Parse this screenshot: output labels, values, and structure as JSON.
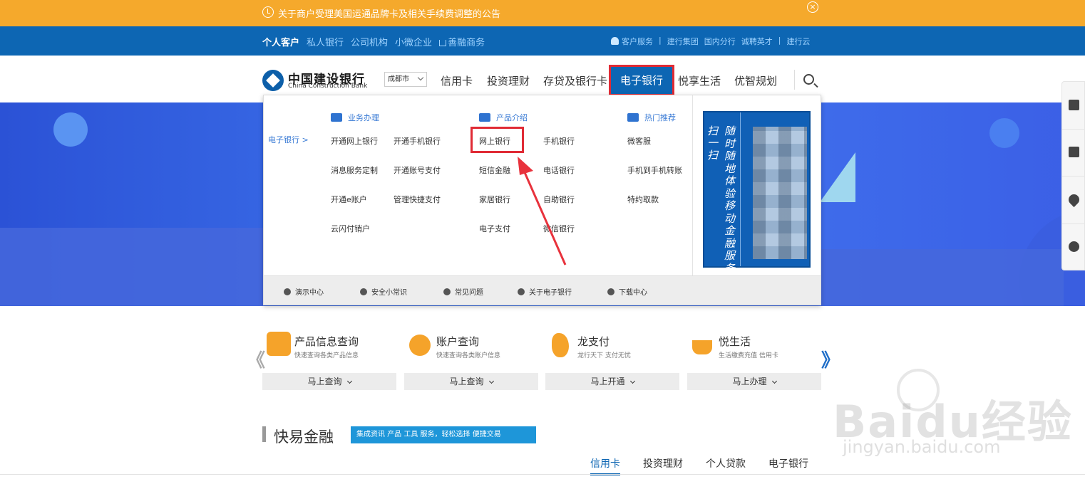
{
  "notice": {
    "text": "关于商户受理美国运通品牌卡及相关手续费调整的公告"
  },
  "topnav": {
    "left": [
      "个人客户",
      "私人银行",
      "公司机构",
      "小微企业",
      "善融商务"
    ],
    "right": [
      "客户服务",
      "|",
      "建行集团",
      "国内分行",
      "诚聘英才",
      "|",
      "建行云"
    ]
  },
  "header": {
    "logo_cn": "中国建设银行",
    "logo_en": "China Construction Bank",
    "city": "成都市",
    "nav": [
      "信用卡",
      "投资理财",
      "存贷及银行卡",
      "电子银行",
      "悦享生活",
      "优智规划"
    ]
  },
  "dropdown": {
    "category": "电子银行 >",
    "sections": {
      "business": "业务办理",
      "products": "产品介绍",
      "hot": "热门推荐"
    },
    "business_items": [
      "开通网上银行",
      "开通手机银行",
      "消息服务定制",
      "开通账号支付",
      "开通e账户",
      "管理快捷支付",
      "云闪付销户"
    ],
    "product_items": [
      "网上银行",
      "手机银行",
      "短信金融",
      "电话银行",
      "家居银行",
      "自助银行",
      "电子支付",
      "微信银行"
    ],
    "hot_items": [
      "微客服",
      "手机到手机转账",
      "特约取款"
    ],
    "promo_v1": "扫一扫",
    "promo_v2": "随时随地体验移动金融服务",
    "footer": [
      "演示中心",
      "安全小常识",
      "常见问题",
      "关于电子银行",
      "下载中心"
    ]
  },
  "services": [
    {
      "title": "产品信息查询",
      "desc": "快速查询各类产品信息",
      "button": "马上查询"
    },
    {
      "title": "账户查询",
      "desc": "快速查询各类账户信息",
      "button": "马上查询"
    },
    {
      "title": "龙支付",
      "desc": "龙行天下 支付无忧",
      "button": "马上开通"
    },
    {
      "title": "悦生活",
      "desc": "生活缴费充值 信用卡",
      "button": "马上办理"
    }
  ],
  "pager": {
    "prev": "《",
    "next": "》"
  },
  "quick_finance": {
    "title": "快易金融",
    "tag": "集成资讯 产品 工具 服务，轻松选择 便捷交易",
    "tabs": [
      "信用卡",
      "投资理财",
      "个人贷款",
      "电子银行"
    ]
  },
  "watermark": {
    "brand": "Baidu经验",
    "url": "jingyan.baidu.com"
  },
  "colors": {
    "primary": "#0d66b3",
    "notice": "#f5a92c",
    "highlight": "#e02b35"
  }
}
